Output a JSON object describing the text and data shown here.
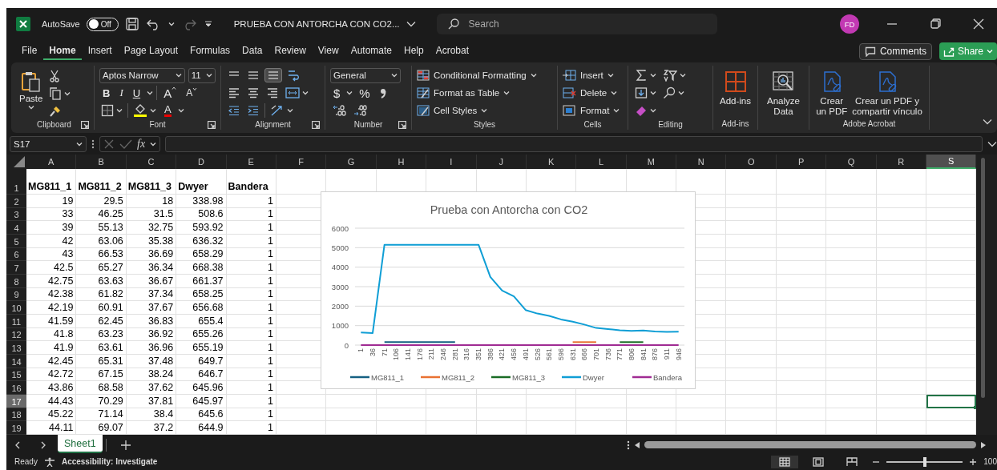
{
  "title_bar": {
    "autosave_label": "AutoSave",
    "autosave_toggle": {
      "on": false,
      "label": "Off"
    },
    "document_title": "PRUEBA CON ANTORCHA CON CO2...",
    "search": {
      "placeholder": "Search"
    },
    "account_initials": "FD"
  },
  "ribbon_tabs": [
    {
      "label": "File",
      "selected": false
    },
    {
      "label": "Home",
      "selected": true
    },
    {
      "label": "Insert",
      "selected": false
    },
    {
      "label": "Page Layout",
      "selected": false
    },
    {
      "label": "Formulas",
      "selected": false
    },
    {
      "label": "Data",
      "selected": false
    },
    {
      "label": "Review",
      "selected": false
    },
    {
      "label": "View",
      "selected": false
    },
    {
      "label": "Automate",
      "selected": false
    },
    {
      "label": "Help",
      "selected": false
    },
    {
      "label": "Acrobat",
      "selected": false
    }
  ],
  "comments_button": "Comments",
  "share_button": "Share",
  "ribbon_groups": [
    {
      "kind": "clipboard",
      "label": "Clipboard",
      "paste": "Paste"
    },
    {
      "kind": "font",
      "label": "Font",
      "font_name": "Aptos Narrow",
      "font_size": "11",
      "bold": "B",
      "italic": "I",
      "underline": "U",
      "grow_font": "A",
      "shrink_font": "A",
      "font_color": "A"
    },
    {
      "kind": "alignment",
      "label": "Alignment"
    },
    {
      "kind": "number",
      "label": "Number",
      "format": "General",
      "currency": "$",
      "percent": "%"
    },
    {
      "kind": "styles",
      "label": "Styles",
      "commands": [
        "Conditional Formatting",
        "Format as Table",
        "Cell Styles"
      ]
    },
    {
      "kind": "cells",
      "label": "Cells",
      "commands": [
        "Insert",
        "Delete",
        "Format"
      ]
    },
    {
      "kind": "editing",
      "label": "Editing"
    },
    {
      "kind": "addins",
      "label": "Add-ins",
      "command": "Add-ins"
    },
    {
      "kind": "analyze",
      "command": "Analyze\nData"
    },
    {
      "kind": "acrobat",
      "label": "Adobe Acrobat",
      "commands": [
        "Crear\nun PDF",
        "Crear un PDF y\ncompartir vínculo"
      ]
    }
  ],
  "formula_bar": {
    "name_box": "S17",
    "function_label": "fx"
  },
  "sheet": {
    "columns": [
      {
        "label": "A",
        "selected": false
      },
      {
        "label": "B",
        "selected": false
      },
      {
        "label": "C",
        "selected": false
      },
      {
        "label": "D",
        "selected": false
      },
      {
        "label": "E",
        "selected": false
      },
      {
        "label": "F",
        "selected": false
      },
      {
        "label": "G",
        "selected": false
      },
      {
        "label": "H",
        "selected": false
      },
      {
        "label": "I",
        "selected": false
      },
      {
        "label": "J",
        "selected": false
      },
      {
        "label": "K",
        "selected": false
      },
      {
        "label": "L",
        "selected": false
      },
      {
        "label": "M",
        "selected": false
      },
      {
        "label": "N",
        "selected": false
      },
      {
        "label": "O",
        "selected": false
      },
      {
        "label": "P",
        "selected": false
      },
      {
        "label": "Q",
        "selected": false
      },
      {
        "label": "R",
        "selected": false
      },
      {
        "label": "S",
        "selected": true
      }
    ],
    "rows": [
      {
        "number": "1",
        "kind": "header",
        "selected": false,
        "cells": [
          "MG811_1",
          "MG811_2",
          "MG811_3",
          "Dwyer",
          "Bandera"
        ]
      },
      {
        "number": "2",
        "kind": "data",
        "selected": false,
        "cells": [
          "19",
          "29.5",
          "18",
          "338.98",
          "1"
        ]
      },
      {
        "number": "3",
        "kind": "data",
        "selected": false,
        "cells": [
          "33",
          "46.25",
          "31.5",
          "508.6",
          "1"
        ]
      },
      {
        "number": "4",
        "kind": "data",
        "selected": false,
        "cells": [
          "39",
          "55.13",
          "32.75",
          "593.92",
          "1"
        ]
      },
      {
        "number": "5",
        "kind": "data",
        "selected": false,
        "cells": [
          "42",
          "63.06",
          "35.38",
          "636.32",
          "1"
        ]
      },
      {
        "number": "6",
        "kind": "data",
        "selected": false,
        "cells": [
          "43",
          "66.53",
          "36.69",
          "658.29",
          "1"
        ]
      },
      {
        "number": "7",
        "kind": "data",
        "selected": false,
        "cells": [
          "42.5",
          "65.27",
          "36.34",
          "668.38",
          "1"
        ]
      },
      {
        "number": "8",
        "kind": "data",
        "selected": false,
        "cells": [
          "42.75",
          "63.63",
          "36.67",
          "661.37",
          "1"
        ]
      },
      {
        "number": "9",
        "kind": "data",
        "selected": false,
        "cells": [
          "42.38",
          "61.82",
          "37.34",
          "658.25",
          "1"
        ]
      },
      {
        "number": "10",
        "kind": "data",
        "selected": false,
        "cells": [
          "42.19",
          "60.91",
          "37.67",
          "656.68",
          "1"
        ]
      },
      {
        "number": "11",
        "kind": "data",
        "selected": false,
        "cells": [
          "41.59",
          "62.45",
          "36.83",
          "655.4",
          "1"
        ]
      },
      {
        "number": "12",
        "kind": "data",
        "selected": false,
        "cells": [
          "41.8",
          "63.23",
          "36.92",
          "655.26",
          "1"
        ]
      },
      {
        "number": "13",
        "kind": "data",
        "selected": false,
        "cells": [
          "41.9",
          "63.61",
          "36.96",
          "655.19",
          "1"
        ]
      },
      {
        "number": "14",
        "kind": "data",
        "selected": false,
        "cells": [
          "42.45",
          "65.31",
          "37.48",
          "649.7",
          "1"
        ]
      },
      {
        "number": "15",
        "kind": "data",
        "selected": false,
        "cells": [
          "42.72",
          "67.15",
          "38.24",
          "646.7",
          "1"
        ]
      },
      {
        "number": "16",
        "kind": "data",
        "selected": false,
        "cells": [
          "43.86",
          "68.58",
          "37.62",
          "645.96",
          "1"
        ]
      },
      {
        "number": "17",
        "kind": "data",
        "selected": true,
        "cells": [
          "44.43",
          "70.29",
          "37.81",
          "645.97",
          "1"
        ]
      },
      {
        "number": "18",
        "kind": "data",
        "selected": false,
        "cells": [
          "45.22",
          "71.14",
          "38.4",
          "645.6",
          "1"
        ]
      },
      {
        "number": "19",
        "kind": "data",
        "selected": false,
        "cells": [
          "44.11",
          "69.07",
          "37.2",
          "644.9",
          "1"
        ]
      }
    ],
    "chart": {
      "chart_data": {
        "type": "line",
        "title": "Prueba con Antorcha con CO2",
        "categories": [
          "1",
          "36",
          "71",
          "106",
          "141",
          "176",
          "211",
          "246",
          "281",
          "316",
          "351",
          "386",
          "421",
          "456",
          "491",
          "526",
          "561",
          "596",
          "631",
          "666",
          "701",
          "736",
          "771",
          "806",
          "841",
          "876",
          "911",
          "946"
        ],
        "ylim": [
          0,
          6000
        ],
        "yticks": [
          0,
          1000,
          2000,
          3000,
          4000,
          5000,
          6000
        ],
        "grid": true,
        "legend": true,
        "series": [
          {
            "name": "MG811_1",
            "color": "#156082",
            "values": [
              null,
              null,
              150,
              150,
              150,
              150,
              150,
              150,
              150,
              null,
              null,
              null,
              null,
              null,
              null,
              null,
              null,
              null,
              null,
              null,
              null,
              null,
              null,
              null,
              null,
              null,
              null,
              null
            ]
          },
          {
            "name": "MG811_2",
            "color": "#e97132",
            "values": [
              null,
              null,
              null,
              null,
              null,
              null,
              null,
              null,
              null,
              null,
              null,
              null,
              null,
              null,
              null,
              null,
              null,
              null,
              150,
              150,
              150,
              null,
              null,
              null,
              null,
              null,
              null,
              null
            ]
          },
          {
            "name": "MG811_3",
            "color": "#196b24",
            "values": [
              null,
              null,
              null,
              null,
              null,
              null,
              null,
              null,
              null,
              null,
              null,
              null,
              null,
              null,
              null,
              null,
              null,
              null,
              null,
              null,
              null,
              null,
              150,
              150,
              150,
              null,
              null,
              null
            ]
          },
          {
            "name": "Dwyer",
            "color": "#0f9ed5",
            "values": [
              650,
              620,
              5150,
              5150,
              5150,
              5150,
              5150,
              5150,
              5150,
              5150,
              5150,
              3500,
              2800,
              2500,
              1800,
              1620,
              1500,
              1320,
              1200,
              1050,
              880,
              820,
              760,
              730,
              750,
              700,
              680,
              690
            ]
          },
          {
            "name": "Bandera",
            "color": "#a02b93",
            "values": [
              0,
              0,
              0,
              0,
              0,
              0,
              0,
              0,
              0,
              0,
              0,
              0,
              0,
              0,
              0,
              0,
              0,
              0,
              0,
              0,
              0,
              0,
              0,
              0,
              0,
              0,
              0,
              0
            ]
          }
        ]
      }
    }
  },
  "sheet_tabs": [
    {
      "label": "Sheet1",
      "selected": true
    }
  ],
  "status_bar": {
    "mode": "Ready",
    "accessibility": "Accessibility: Investigate",
    "zoom": {
      "level": 0.5,
      "label": "100"
    }
  }
}
